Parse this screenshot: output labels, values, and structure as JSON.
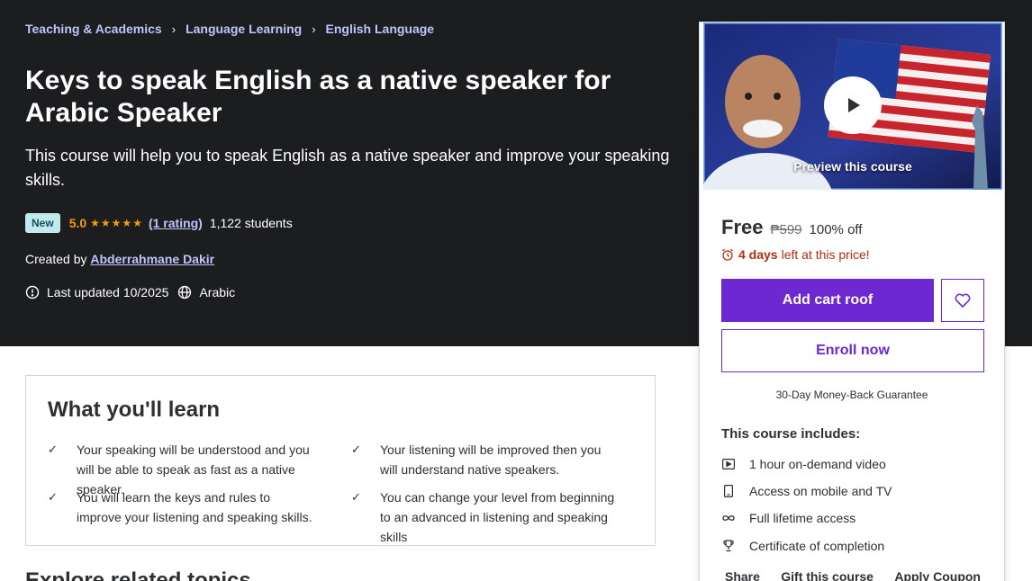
{
  "breadcrumb": [
    "Teaching & Academics",
    "Language Learning",
    "English Language"
  ],
  "course": {
    "title": "Keys to speak English as a native speaker for Arabic Speaker",
    "subtitle": "This course will help you to speak English as a native speaker and improve your speaking skills.",
    "badge": "New",
    "rating": "5.0",
    "stars": "★★★★★",
    "rating_count": "(1 rating)",
    "students": "1,122 students",
    "created_by_label": "Created by",
    "instructor": "Abderrahmane Dakir",
    "last_updated": "Last updated 10/2025",
    "language": "Arabic"
  },
  "learn": {
    "title": "What you'll learn",
    "items": [
      "Your speaking will be understood and you will be able to speak as fast as a native speaker.",
      "Your listening will be improved then you will understand native speakers.",
      "You will learn the keys and rules to improve your listening and speaking skills.",
      "You can change your level from beginning to an advanced in listening and speaking skills"
    ],
    "check": "✓"
  },
  "next_section": "Explore related topics",
  "sidebar": {
    "preview_label": "Preview this course",
    "price": "Free",
    "original_price": "₱599",
    "discount": "100% off",
    "timer_bold": "4 days",
    "timer_rest": "left at this price!",
    "cart_button": "Add cart roof",
    "enroll_button": "Enroll now",
    "guarantee": "30-Day Money-Back Guarantee",
    "includes_title": "This course includes:",
    "includes": [
      {
        "icon": "video-icon",
        "label": "1 hour on-demand video"
      },
      {
        "icon": "mobile-icon",
        "label": "Access on mobile and TV"
      },
      {
        "icon": "infinity-icon",
        "label": "Full lifetime access"
      },
      {
        "icon": "trophy-icon",
        "label": "Certificate of completion"
      }
    ],
    "share": "Share",
    "gift": "Gift this course",
    "coupon": "Apply Coupon"
  },
  "colors": {
    "hero_bg": "#1c1d1f",
    "accent_purple": "#6d28d2",
    "link_lavender": "#c0c4fc",
    "star_orange": "#f69c08",
    "timer_red": "#b32d0f",
    "badge_bg": "#c2e9eb"
  }
}
